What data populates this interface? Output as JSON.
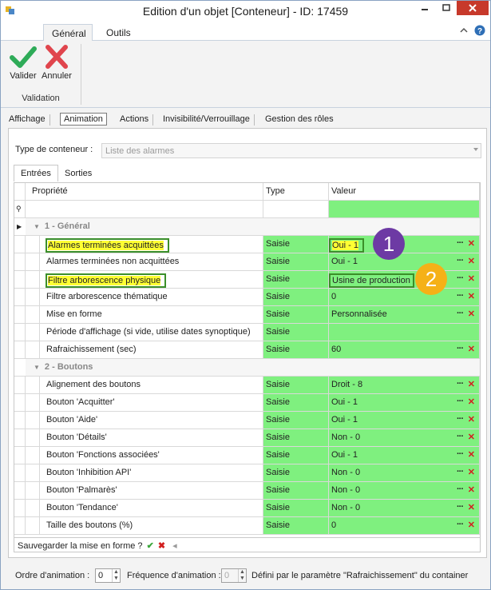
{
  "window": {
    "title": "Edition d'un objet [Conteneur] - ID: 17459"
  },
  "ribbon": {
    "tabs": [
      "Général",
      "Outils"
    ],
    "valider_label": "Valider",
    "annuler_label": "Annuler",
    "group_label": "Validation"
  },
  "section_tabs": [
    "Affichage",
    "Animation",
    "Actions",
    "Invisibilité/Verrouillage",
    "Gestion des rôles"
  ],
  "container_type": {
    "label": "Type de conteneur :",
    "value": "Liste des alarmes"
  },
  "io_tabs": [
    "Entrées",
    "Sorties"
  ],
  "grid": {
    "headers": {
      "property": "Propriété",
      "type": "Type",
      "value": "Valeur"
    },
    "groups": [
      {
        "title": "1 - Général",
        "rows": [
          {
            "property": "Alarmes terminées acquittées",
            "type": "Saisie",
            "value": "Oui - 1"
          },
          {
            "property": "Alarmes terminées non acquittées",
            "type": "Saisie",
            "value": "Oui - 1"
          },
          {
            "property": "Filtre arborescence physique",
            "type": "Saisie",
            "value": "Usine de production"
          },
          {
            "property": "Filtre arborescence thématique",
            "type": "Saisie",
            "value": "0"
          },
          {
            "property": "Mise en forme",
            "type": "Saisie",
            "value": "Personnalisée"
          },
          {
            "property": "Période d'affichage (si vide, utilise dates synoptique)",
            "type": "Saisie",
            "value": ""
          },
          {
            "property": "Rafraichissement (sec)",
            "type": "Saisie",
            "value": "60"
          }
        ]
      },
      {
        "title": "2 - Boutons",
        "rows": [
          {
            "property": "Alignement des boutons",
            "type": "Saisie",
            "value": "Droit - 8"
          },
          {
            "property": "Bouton 'Acquitter'",
            "type": "Saisie",
            "value": "Oui - 1"
          },
          {
            "property": "Bouton 'Aide'",
            "type": "Saisie",
            "value": "Oui - 1"
          },
          {
            "property": "Bouton 'Détails'",
            "type": "Saisie",
            "value": "Non - 0"
          },
          {
            "property": "Bouton 'Fonctions associées'",
            "type": "Saisie",
            "value": "Oui - 1"
          },
          {
            "property": "Bouton 'Inhibition API'",
            "type": "Saisie",
            "value": "Non - 0"
          },
          {
            "property": "Bouton 'Palmarès'",
            "type": "Saisie",
            "value": "Non - 0"
          },
          {
            "property": "Bouton 'Tendance'",
            "type": "Saisie",
            "value": "Non - 0"
          },
          {
            "property": "Taille des boutons (%)",
            "type": "Saisie",
            "value": "0"
          }
        ]
      }
    ],
    "row_actions": {
      "more": "···",
      "remove": "✕"
    }
  },
  "badges": [
    "1",
    "2"
  ],
  "save_layout": {
    "label": "Sauvegarder la mise en forme ?"
  },
  "footer": {
    "order_label": "Ordre d'animation :",
    "order_value": "0",
    "freq_label": "Fréquence d'animation :",
    "freq_value": "0",
    "note": "Défini par le paramètre \"Rafraichissement\" du container"
  }
}
